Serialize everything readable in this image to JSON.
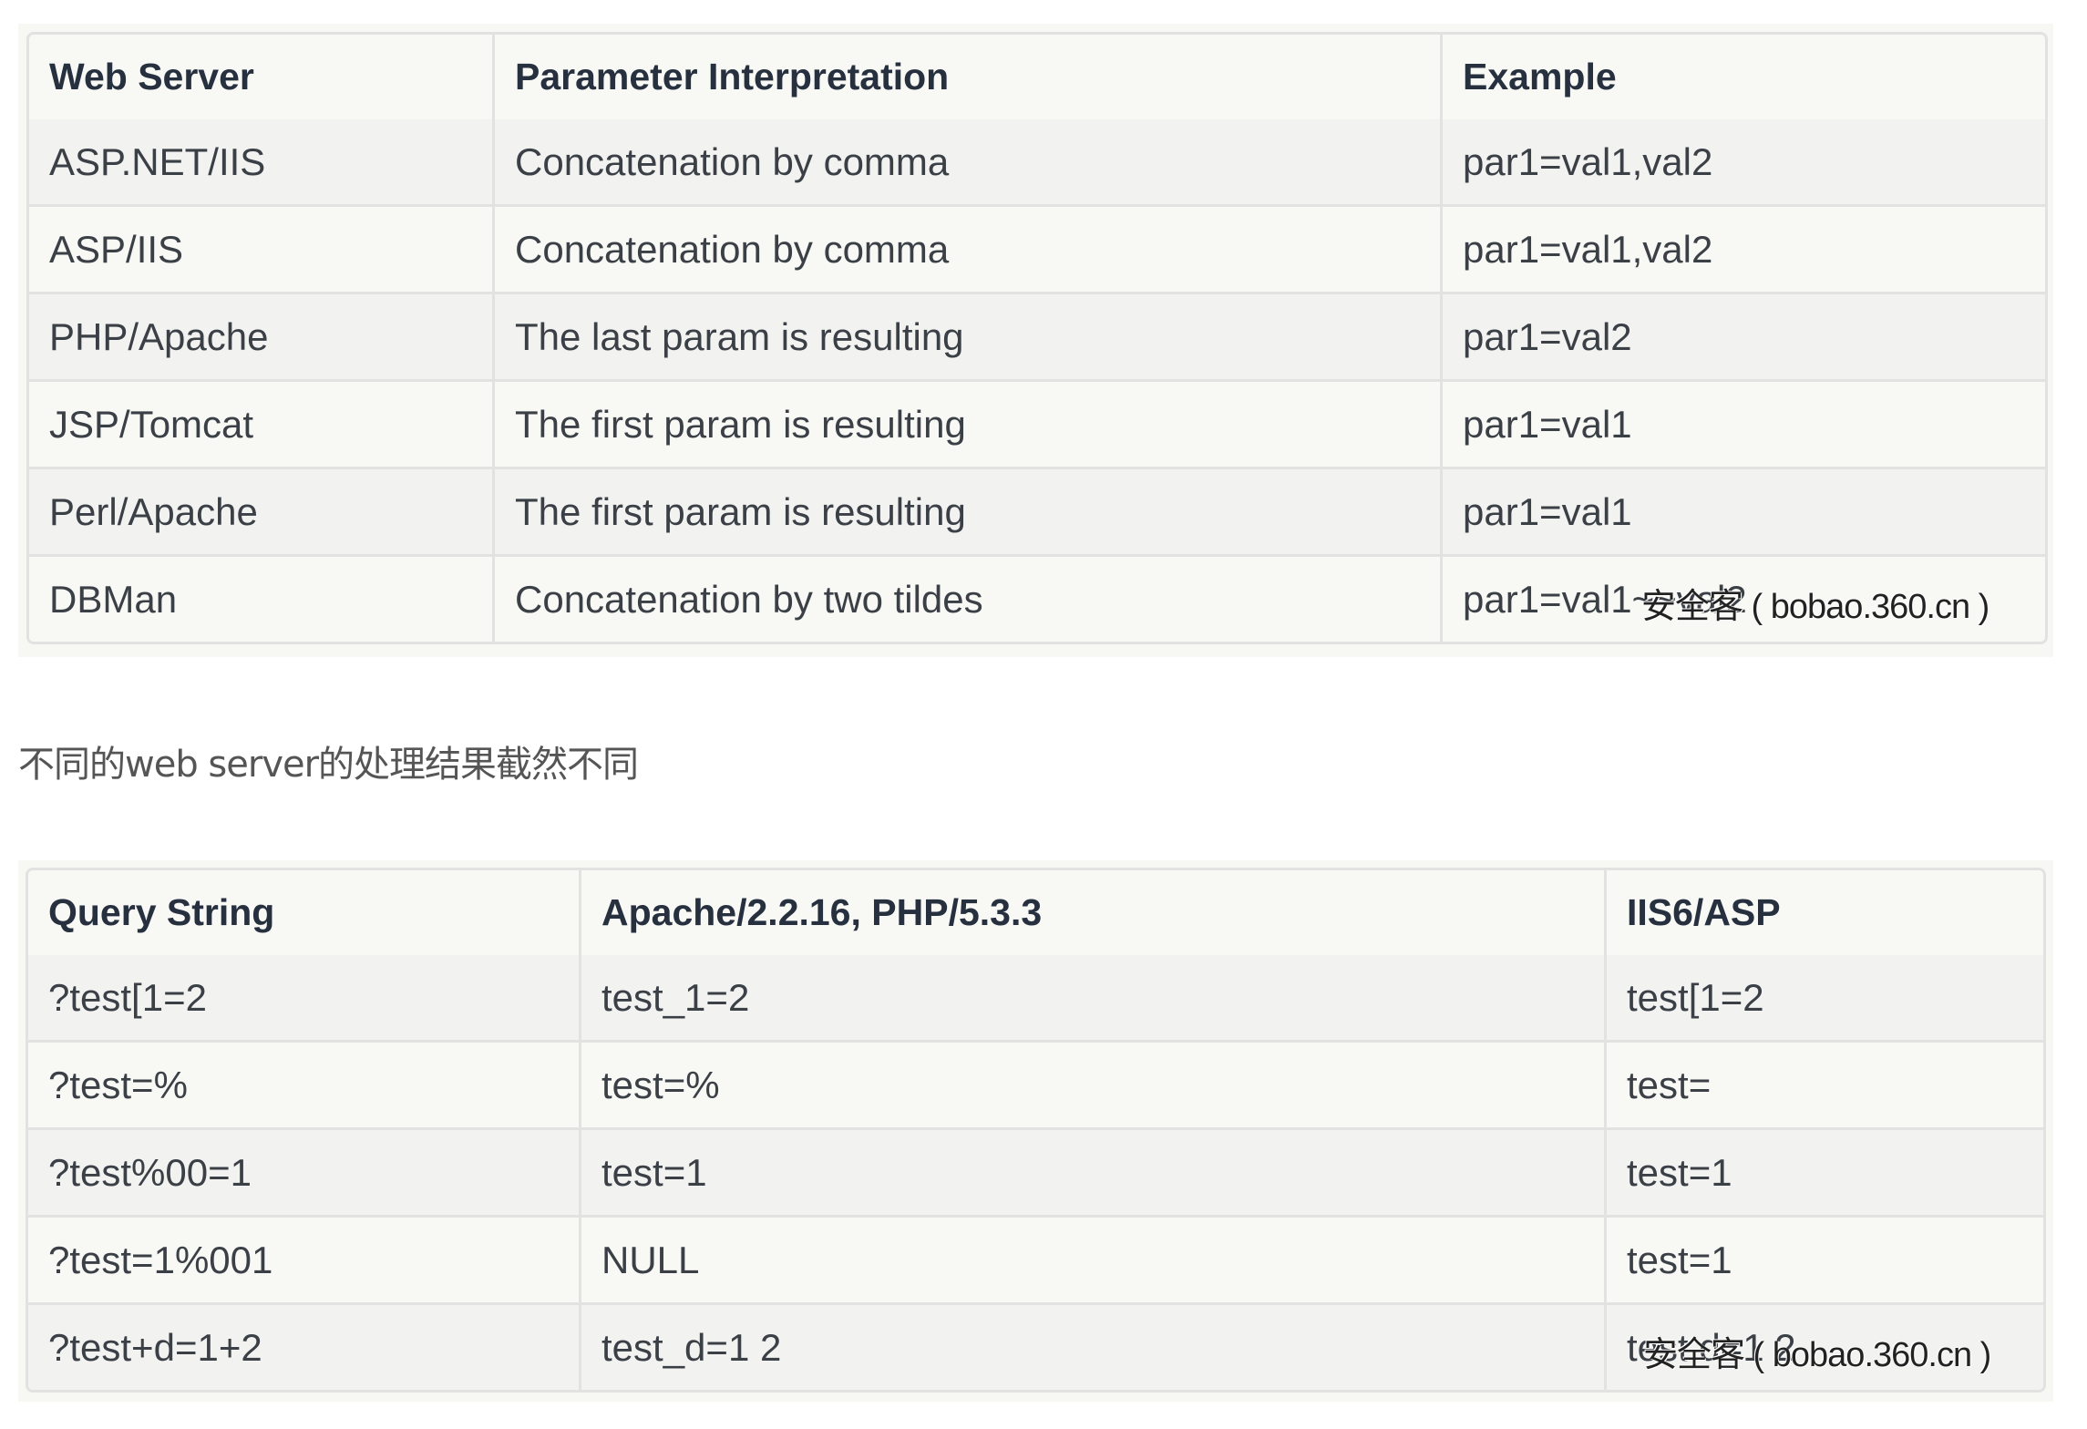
{
  "table1": {
    "headers": [
      "Web Server",
      "Parameter Interpretation",
      "Example"
    ],
    "rows": [
      [
        "ASP.NET/IIS",
        "Concatenation by comma",
        "par1=val1,val2"
      ],
      [
        "ASP/IIS",
        "Concatenation by comma",
        "par1=val1,val2"
      ],
      [
        "PHP/Apache",
        "The last param is resulting",
        "par1=val2"
      ],
      [
        "JSP/Tomcat",
        "The first param is resulting",
        "par1=val1"
      ],
      [
        "Perl/Apache",
        "The first param is resulting",
        "par1=val1"
      ],
      [
        "DBMan",
        "Concatenation by two tildes",
        "par1=val1~~val2"
      ]
    ],
    "watermark": "安全客 ( bobao.360.cn )"
  },
  "note": "不同的web server的处理结果截然不同",
  "table2": {
    "headers": [
      "Query String",
      "Apache/2.2.16, PHP/5.3.3",
      "IIS6/ASP"
    ],
    "rows": [
      [
        "?test[1=2",
        "test_1=2",
        "test[1=2"
      ],
      [
        "?test=%",
        "test=%",
        "test="
      ],
      [
        "?test%00=1",
        "test=1",
        "test=1"
      ],
      [
        "?test=1%001",
        "NULL",
        "test=1"
      ],
      [
        "?test+d=1+2",
        "test_d=1 2",
        "test d=1 2"
      ]
    ],
    "watermark": "安全客 ( bobao.360.cn )"
  }
}
